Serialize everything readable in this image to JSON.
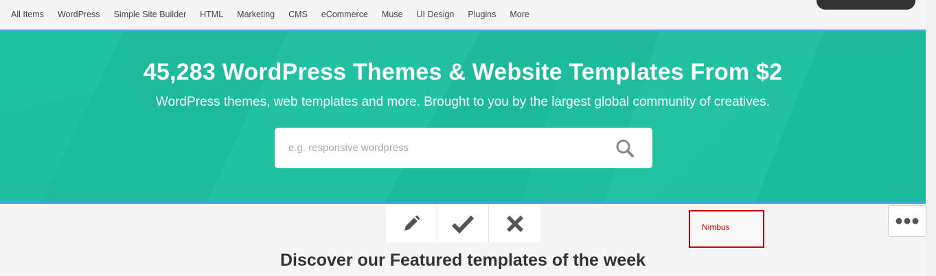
{
  "nav": {
    "items": [
      "All Items",
      "WordPress",
      "Simple Site Builder",
      "HTML",
      "Marketing",
      "CMS",
      "eCommerce",
      "Muse",
      "UI Design",
      "Plugins",
      "More"
    ]
  },
  "hero": {
    "title": "45,283 WordPress Themes & Website Templates From $2",
    "subtitle": "WordPress themes, web templates and more. Brought to you by the largest global community of creatives.",
    "search_placeholder": "e.g. responsive wordpress",
    "search_value": "",
    "search_icon": "search-icon"
  },
  "toolbar": {
    "icons": [
      "pencil-icon",
      "check-icon",
      "close-icon"
    ]
  },
  "nimbus": {
    "label": "Nimbus"
  },
  "more_button": {
    "icon": "more-horizontal-icon"
  },
  "featured": {
    "heading": "Discover our Featured templates of the week"
  },
  "colors": {
    "hero_bg": "#1fbf9f",
    "hero_border": "#4aa5e6",
    "nimbus_red": "#d30000",
    "text_dark": "#333333"
  }
}
